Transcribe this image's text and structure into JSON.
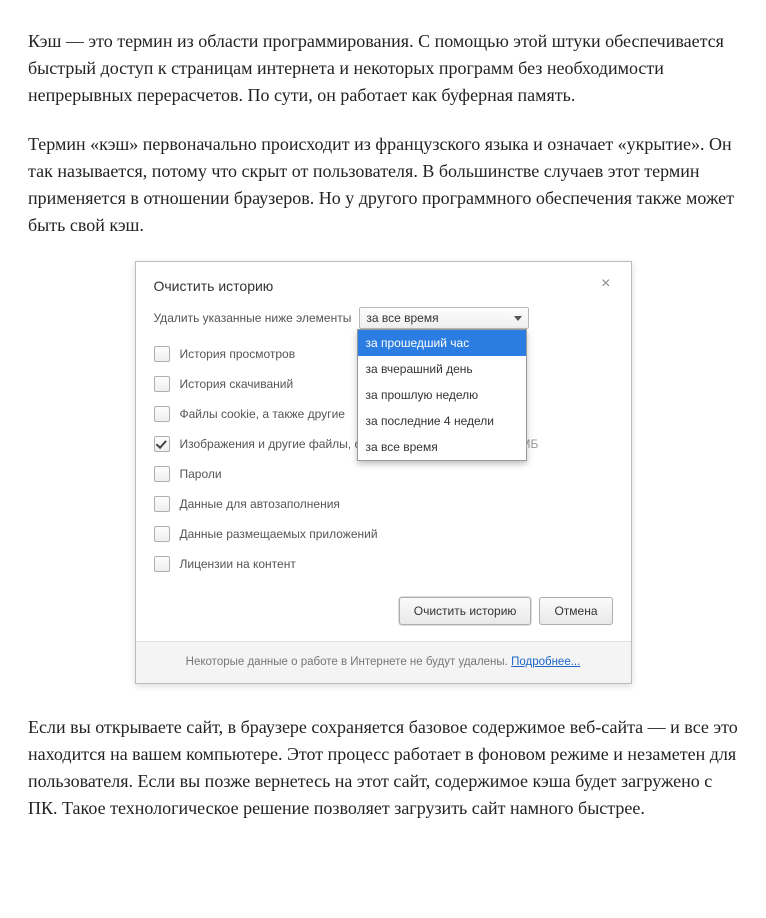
{
  "article": {
    "p1": "Кэш — это термин из области программирования. С помощью этой штуки обеспечивается быстрый доступ к страницам интернета и некоторых программ без необходимости непрерывных перерасчетов. По сути, он работает как буферная память.",
    "p2": "Термин «кэш» первоначально происходит из французского языка и означает «укрытие». Он так называется, потому что скрыт от пользователя. В большинстве случаев этот термин применяется в отношении браузеров. Но у другого программного обеспечения также может быть свой кэш.",
    "p3": "Если вы открываете сайт, в браузере сохраняется базовое содержимое веб-сайта — и все это находится на вашем компьютере. Этот процесс работает в фоновом режиме и незаметен для пользователя. Если вы позже вернетесь на этот сайт, содержимое кэша будет загружено с ПК. Такое технологическое решение позволяет загрузить сайт намного быстрее."
  },
  "dialog": {
    "title": "Очистить историю",
    "close": "×",
    "select_label": "Удалить указанные ниже элементы",
    "select_value": "за все время",
    "dropdown": {
      "items": [
        "за прошедший час",
        "за вчерашний день",
        "за прошлую неделю",
        "за последние 4 недели",
        "за все время"
      ],
      "highlight_index": 0
    },
    "checks": [
      {
        "label": "История просмотров",
        "checked": false
      },
      {
        "label": "История скачиваний",
        "checked": false
      },
      {
        "label": "Файлы cookie, а также другие",
        "checked": false
      },
      {
        "label": "Изображения и другие файлы, сохраненные в кеше",
        "checked": true,
        "extra": "–  17,5 МБ"
      },
      {
        "label": "Пароли",
        "checked": false
      },
      {
        "label": "Данные для автозаполнения",
        "checked": false
      },
      {
        "label": "Данные размещаемых приложений",
        "checked": false
      },
      {
        "label": "Лицензии на контент",
        "checked": false
      }
    ],
    "buttons": {
      "primary": "Очистить историю",
      "cancel": "Отмена"
    },
    "note_text": "Некоторые данные о работе в Интернете не будут удалены. ",
    "note_link": "Подробнее..."
  }
}
